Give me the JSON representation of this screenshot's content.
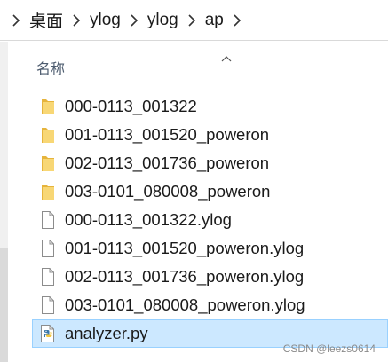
{
  "breadcrumb": {
    "items": [
      "桌面",
      "ylog",
      "ylog",
      "ap"
    ],
    "separator_icon": "chevron-right-icon"
  },
  "column_header": {
    "name_label": "名称",
    "sort_icon": "sort-ascending-icon"
  },
  "files": [
    {
      "name": "000-0113_001322",
      "type": "folder",
      "icon": "folder-icon",
      "selected": false
    },
    {
      "name": "001-0113_001520_poweron",
      "type": "folder",
      "icon": "folder-icon",
      "selected": false
    },
    {
      "name": "002-0113_001736_poweron",
      "type": "folder",
      "icon": "folder-icon",
      "selected": false
    },
    {
      "name": "003-0101_080008_poweron",
      "type": "folder",
      "icon": "folder-icon",
      "selected": false
    },
    {
      "name": "000-0113_001322.ylog",
      "type": "file",
      "icon": "document-icon",
      "selected": false
    },
    {
      "name": "001-0113_001520_poweron.ylog",
      "type": "file",
      "icon": "document-icon",
      "selected": false
    },
    {
      "name": "002-0113_001736_poweron.ylog",
      "type": "file",
      "icon": "document-icon",
      "selected": false
    },
    {
      "name": "003-0101_080008_poweron.ylog",
      "type": "file",
      "icon": "document-icon",
      "selected": false
    },
    {
      "name": "analyzer.py",
      "type": "python",
      "icon": "python-file-icon",
      "selected": true
    }
  ],
  "colors": {
    "selection_bg": "#cce8ff",
    "selection_border": "#99d1ff",
    "folder_fill": "#f8d775",
    "folder_dark": "#e6b43c"
  },
  "watermark": "CSDN @leezs0614"
}
